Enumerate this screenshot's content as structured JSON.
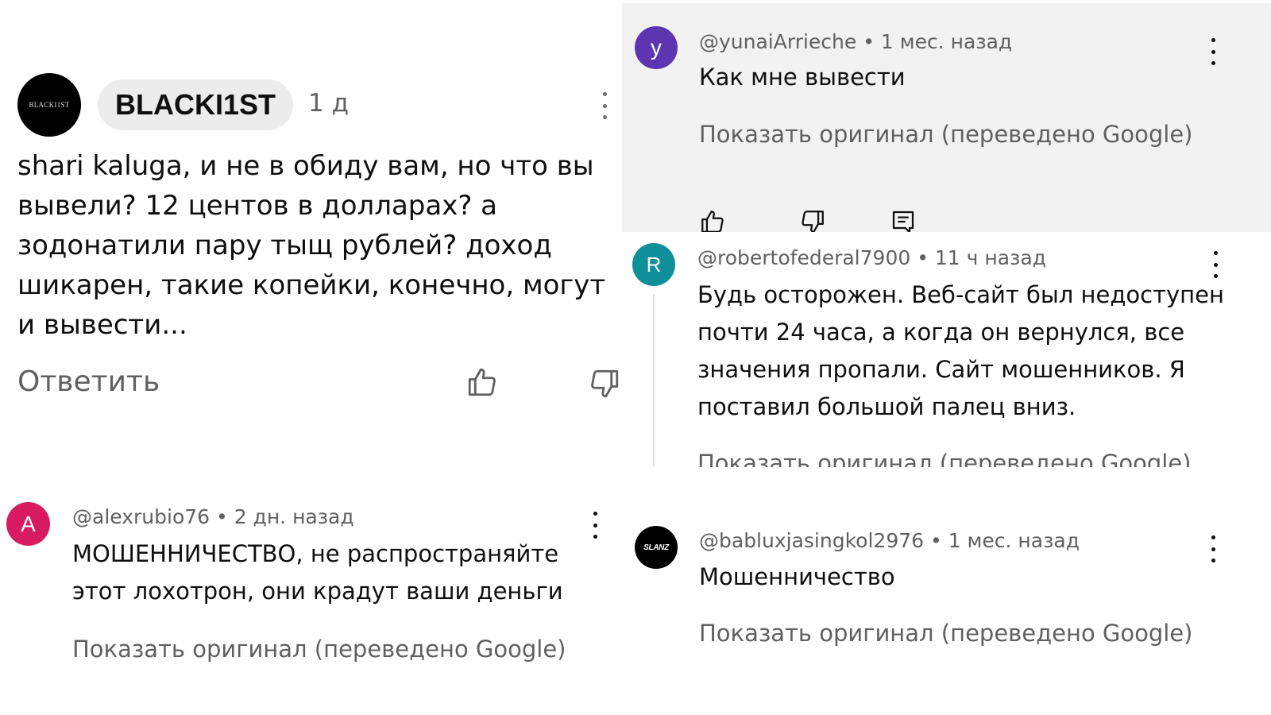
{
  "colors": {
    "grey_panel": "#f2f2f2",
    "avatar_y": "#5e35b1",
    "avatar_r": "#0f8f9a",
    "avatar_a": "#d81b60",
    "avatar_black": "#000000",
    "meta_text": "#606060"
  },
  "comment_main": {
    "avatar_text": "BLACKI1ST",
    "author": "BLACKI1ST",
    "time": "1 д",
    "text_lines": [
      "shari kaluga, и не в обиду вам, но что вы",
      "вывели? 12 центов в долларах? а",
      "зодонатили пару тыщ рублей? доход",
      "шикарен, такие копейки, конечно, могут",
      "и вывести..."
    ],
    "reply_label": "Ответить",
    "icons": [
      "thumbs-up-icon",
      "thumbs-down-icon",
      "more-vert-icon"
    ]
  },
  "comment_yunai": {
    "avatar_letter": "y",
    "author": "@yunaiArrieche",
    "time": "1 мес. назад",
    "text": "Как мне вывести",
    "show_original": "Показать оригинал (переведено Google)",
    "icons": [
      "thumbs-up-icon",
      "thumbs-down-icon",
      "comment-icon",
      "more-vert-icon"
    ]
  },
  "comment_roberto": {
    "avatar_letter": "R",
    "author": "@robertofederal7900",
    "time": "11 ч назад",
    "text_lines": [
      "Будь осторожен. Веб-сайт был недоступен",
      "почти 24 часа, а когда он вернулся, все",
      "значения пропали. Сайт мошенников. Я",
      "поставил большой палец вниз."
    ],
    "show_original": "Показать оригинал (переведено Google)"
  },
  "comment_alex": {
    "avatar_letter": "A",
    "author": "@alexrubio76",
    "time": "2 дн. назад",
    "text_lines": [
      "МОШЕННИЧЕСТВО, не распространяйте",
      "этот лохотрон, они крадут ваши деньги"
    ],
    "show_original": "Показать оригинал (переведено Google)"
  },
  "comment_bablu": {
    "avatar_text": "SLANZ",
    "author": "@babluxjasingkol2976",
    "time": "1 мес. назад",
    "text": "Мошенничество",
    "show_original": "Показать оригинал (переведено Google)"
  },
  "separator": " • "
}
